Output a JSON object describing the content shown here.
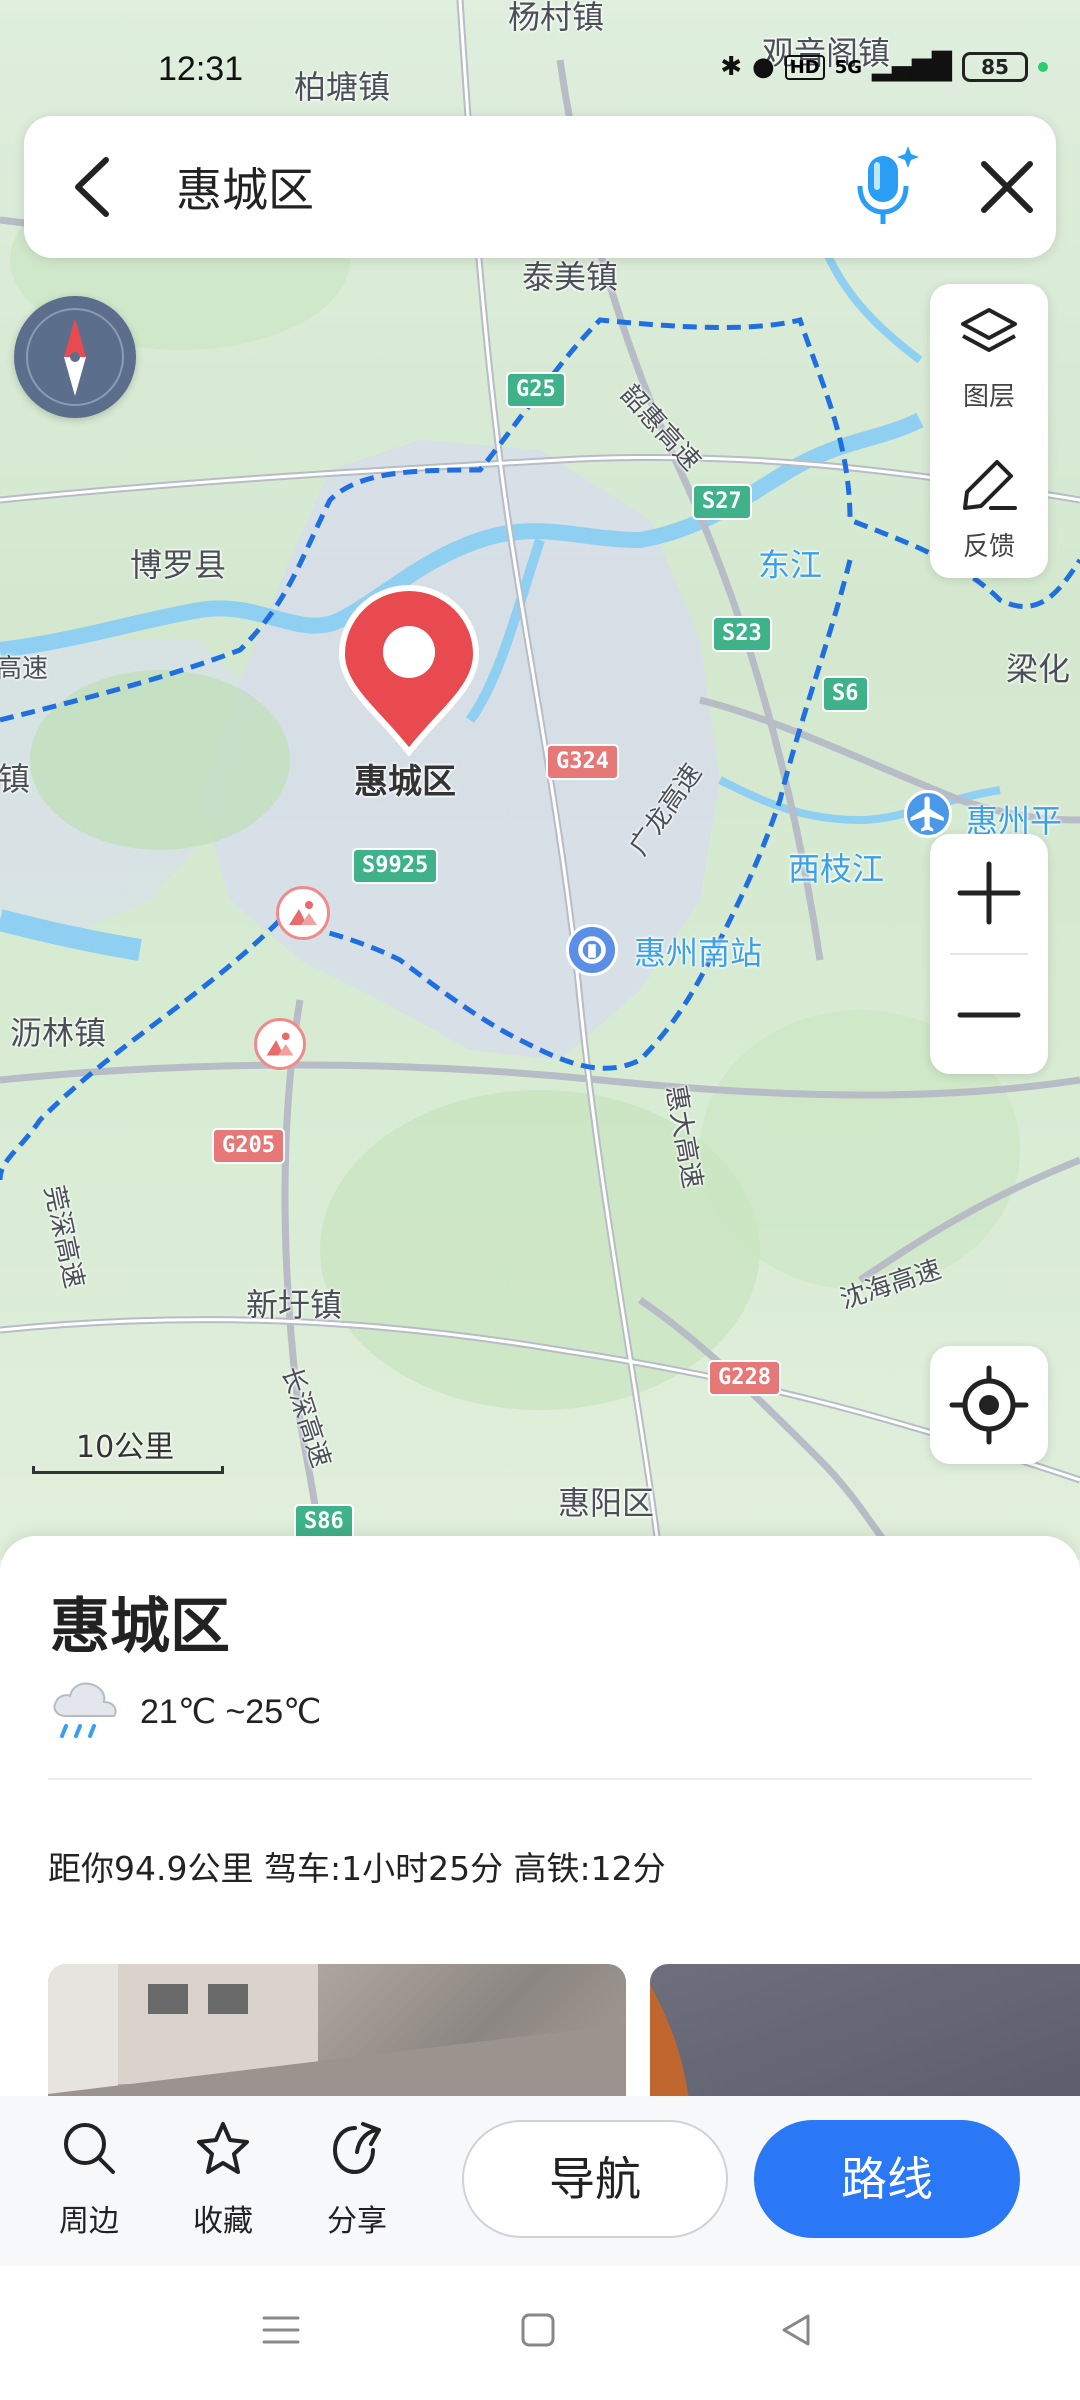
{
  "status_bar": {
    "time": "12:31",
    "network": "5G",
    "hd": "HD",
    "battery": "85"
  },
  "search": {
    "query": "惠城区"
  },
  "map": {
    "labels": {
      "yangcun": "杨村镇",
      "baitang": "柏塘镇",
      "guanyinge": "观音阁镇",
      "taimei": "泰美镇",
      "boluo": "博罗县",
      "lianghua": "梁化",
      "zhen_left": "镇",
      "gaosu_left": "高速",
      "huicheng": "惠城区",
      "dongjiang": "东江",
      "xizhijiang": "西枝江",
      "huizhou_airport": "惠州平",
      "huizhou_south": "惠州南站",
      "lilin": "沥林镇",
      "xinxu": "新圩镇",
      "huiyang": "惠阳区",
      "shaohui": "韶惠高速",
      "guanglong": "广龙高速",
      "huida": "惠大高速",
      "zhenshen": "莞深高速",
      "changshen": "长深高速",
      "shenshan": "沈海高速"
    },
    "roads": {
      "g25": "G25",
      "s27": "S27",
      "s23": "S23",
      "s6": "S6",
      "g324": "G324",
      "s9925": "S9925",
      "g205": "G205",
      "g228": "G228",
      "s86": "S86"
    },
    "tools": {
      "layers": "图层",
      "feedback": "反馈"
    },
    "scale": "10公里"
  },
  "sheet": {
    "title": "惠城区",
    "weather": "21℃ ~25℃",
    "distance_info": "距你94.9公里 驾车:1小时25分 高铁:12分"
  },
  "actions": {
    "nearby": "周边",
    "favorite": "收藏",
    "share": "分享",
    "navigate": "导航",
    "route": "路线"
  },
  "colors": {
    "accent": "#2a78f5",
    "pin": "#e84a4f",
    "boundary": "#1f6fe0"
  }
}
